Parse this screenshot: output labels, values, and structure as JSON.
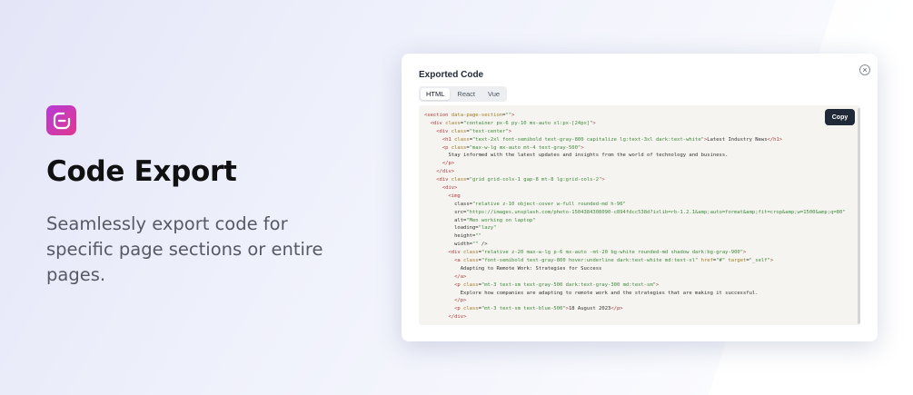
{
  "hero": {
    "title": "Code Export",
    "description": "Seamlessly export code for specific page sections or entire pages."
  },
  "modal": {
    "title": "Exported Code",
    "close_icon": "close-circle-icon",
    "tabs": [
      {
        "label": "HTML",
        "active": true
      },
      {
        "label": "React",
        "active": false
      },
      {
        "label": "Vue",
        "active": false
      }
    ],
    "copy_label": "Copy",
    "code_lines": [
      "<section data-page-section=\"\">",
      "  <div class=\"container px-6 py-10 mx-auto xl:px-[24px]\">",
      "    <div class=\"text-center\">",
      "      <h1 class=\"text-2xl font-semibold text-gray-800 capitalize lg:text-3xl dark:text-white\">Latest Industry News</h1>",
      "      <p class=\"max-w-lg mx-auto mt-4 text-gray-500\">",
      "        Stay informed with the latest updates and insights from the world of technology and business.",
      "      </p>",
      "    </div>",
      "    <div class=\"grid grid-cols-1 gap-8 mt-8 lg:grid-cols-2\">",
      "      <div>",
      "        <img",
      "          class=\"relative z-10 object-cover w-full rounded-md h-96\"",
      "          src=\"https://images.unsplash.com/photo-1504384308090-c894fdcc538d?ixlib=rb-1.2.1&amp;auto=format&amp;fit=crop&amp;w=1500&amp;q=80\"",
      "          alt=\"Men working on laptop\"",
      "          loading=\"lazy\"",
      "          height=\"\"",
      "          width=\"\" />",
      "        <div class=\"relative z-20 max-w-lg p-6 mx-auto -mt-20 bg-white rounded-md shadow dark:bg-gray-900\">",
      "          <a class=\"font-semibold text-gray-800 hover:underline dark:text-white md:text-xl\" href=\"#\" target=\"_self\">",
      "            Adapting to Remote Work: Strategies for Success",
      "          </a>",
      "          <p class=\"mt-3 text-sm text-gray-500 dark:text-gray-300 md:text-sm\">",
      "            Explore how companies are adapting to remote work and the strategies that are making it successful.",
      "          </p>",
      "          <p class=\"mt-3 text-sm text-blue-500\">18 August 2023</p>",
      "        </div>"
    ]
  },
  "colors": {
    "tag": "#b43b3b",
    "attr": "#a07a20",
    "string": "#3f8a3a",
    "text": "#333333",
    "logo_start": "#b63bd8",
    "logo_end": "#e0388d",
    "copy_bg": "#1f2937"
  },
  "icons": {
    "logo": "brand-e-logo-icon"
  }
}
